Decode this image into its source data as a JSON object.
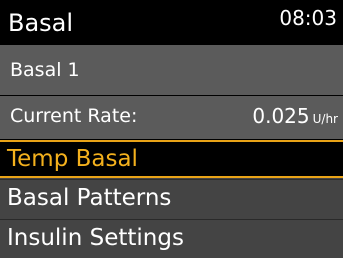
{
  "header": {
    "title": "Basal",
    "time": "08:03"
  },
  "info": {
    "pattern_name": "Basal 1",
    "current_rate_label": "Current Rate:",
    "current_rate_value": "0.025",
    "current_rate_unit": "U/hr"
  },
  "menu": {
    "items": [
      {
        "label": "Temp Basal",
        "selected": true
      },
      {
        "label": "Basal Patterns",
        "selected": false
      },
      {
        "label": "Insulin Settings",
        "selected": false
      }
    ]
  },
  "colors": {
    "header_bg": "#000000",
    "info_bg": "#5b5b5b",
    "menu_bg": "#444444",
    "selected_accent": "#e9a317",
    "selected_text": "#f4b11d",
    "text": "#ffffff"
  }
}
